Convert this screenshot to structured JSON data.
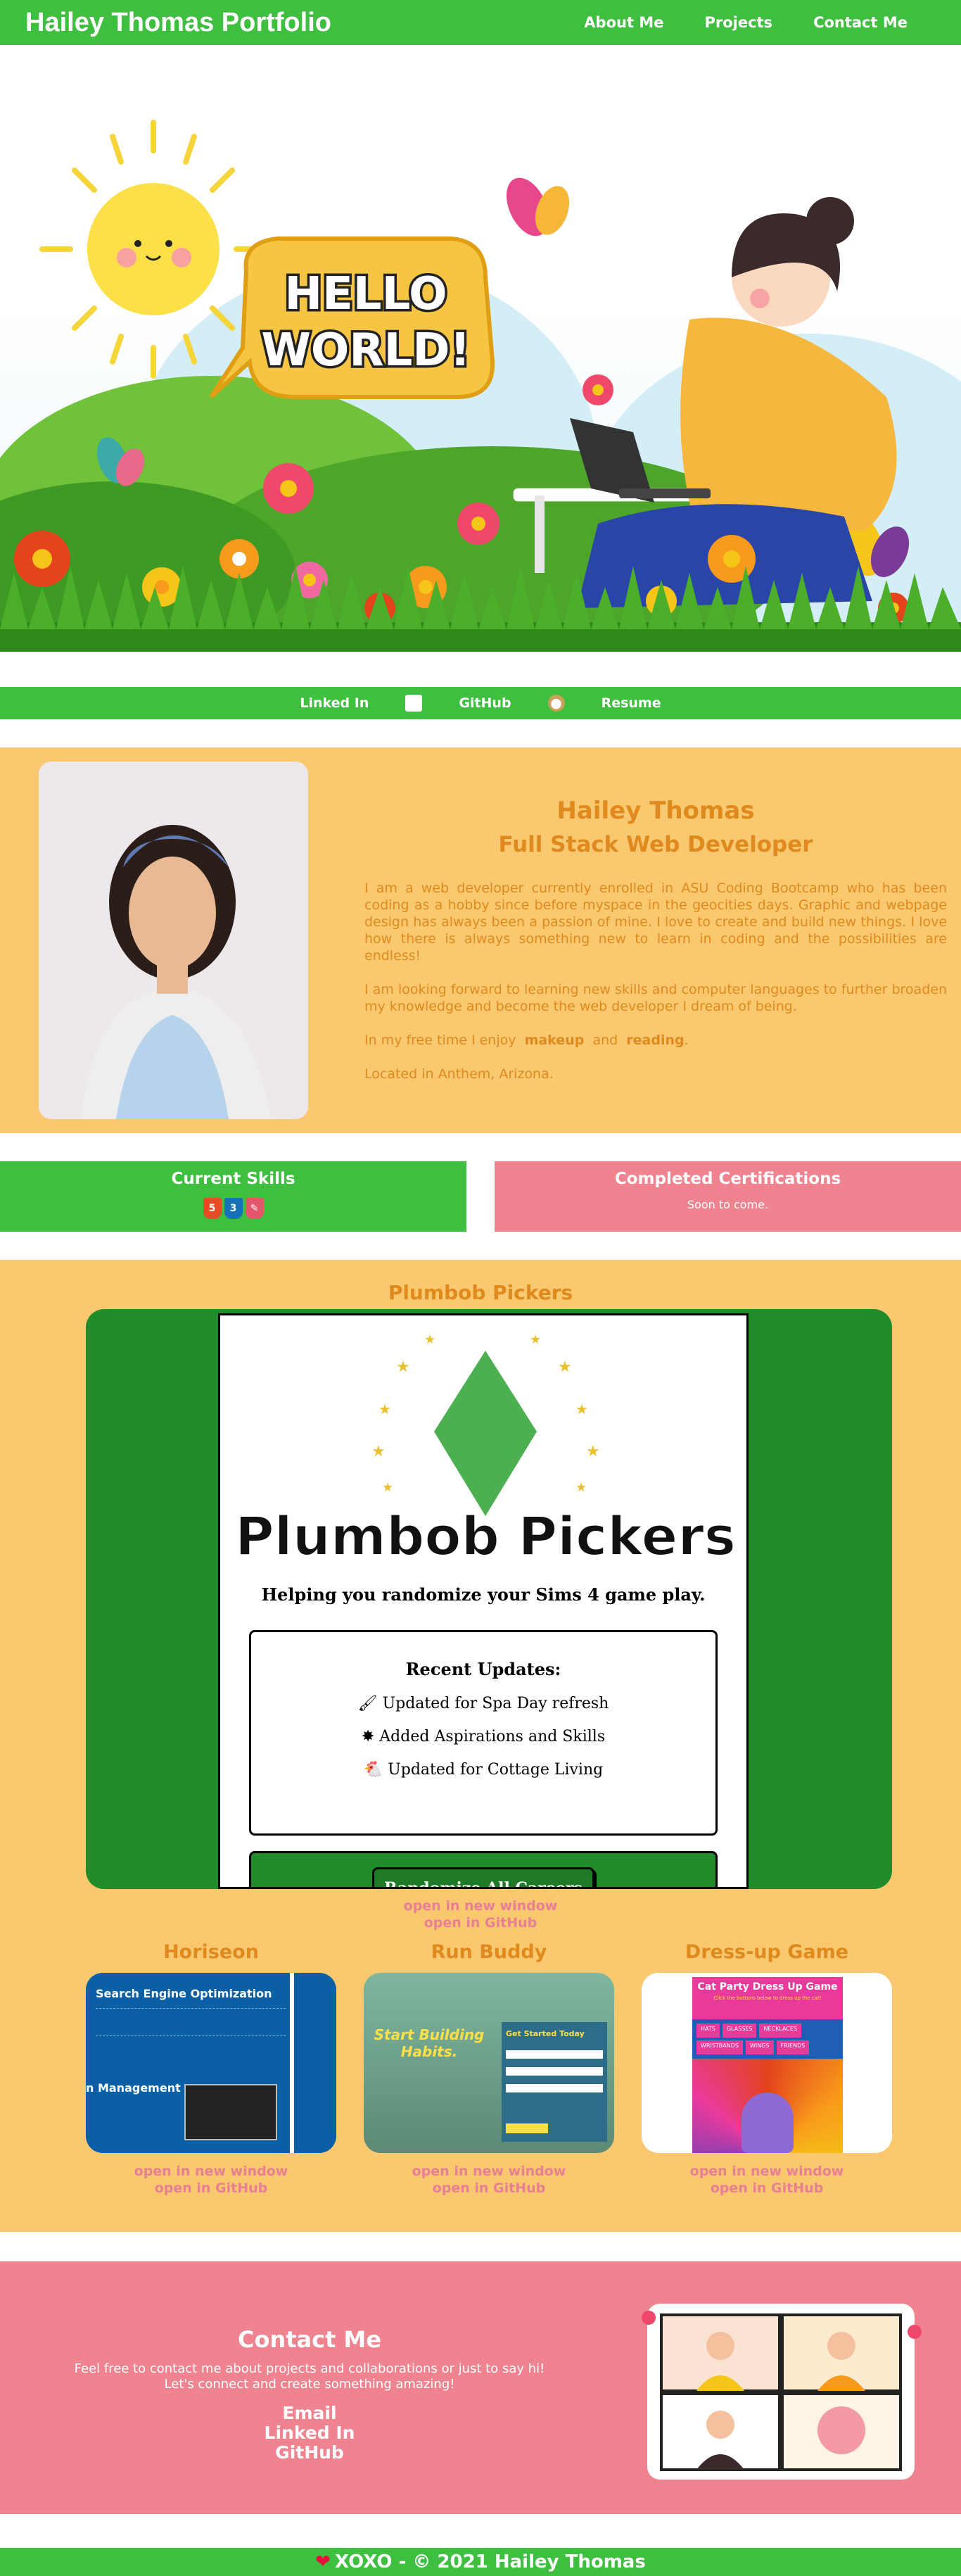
{
  "header": {
    "title": "Hailey Thomas Portfolio",
    "nav": [
      "About Me",
      "Projects",
      "Contact Me"
    ]
  },
  "hero": {
    "speech_bubble": [
      "HELLO",
      "WORLD!"
    ]
  },
  "social": {
    "linkedin": "Linked In",
    "github": "GitHub",
    "resume": "Resume"
  },
  "about": {
    "name": "Hailey Thomas",
    "role": "Full Stack Web Developer",
    "p1": "I am a web developer currently enrolled in ASU Coding Bootcamp who has been coding as a hobby since before myspace in the geocities days. Graphic and webpage design has always been a passion of mine. I love to create and build new things. I love how there is always something new to learn in coding and the possibilities are endless!",
    "p2": "I am looking forward to learning new skills and computer languages to further broaden my knowledge and become the web developer I dream of being.",
    "p3_pre": "In my free time I enjoy",
    "hobby1": "makeup",
    "p3_and": "and",
    "hobby2": "reading",
    "p3_end": ".",
    "p4": "Located in Anthem, Arizona."
  },
  "skills": {
    "title": "Current Skills",
    "icons": [
      "html5-icon",
      "css3-icon",
      "javascript-icon"
    ]
  },
  "certs": {
    "title": "Completed Certifications",
    "text": "Soon to come."
  },
  "projects": {
    "featured_title": "Plumbob Pickers",
    "app": {
      "logo_text": "Plumbob Pickers",
      "tagline": "Helping you randomize your Sims 4 game play.",
      "updates_title": "Recent Updates:",
      "updates": [
        "Updated for Spa Day refresh",
        "Added Aspirations and Skills",
        "Updated for Cottage Living"
      ],
      "button": "Randomize All Careers"
    },
    "link_window": "open in new window",
    "link_github": "open in GitHub",
    "cards": [
      {
        "title": "Horiseon",
        "thumb_heading": "Search Engine Optimization",
        "thumb_sub": "n Management"
      },
      {
        "title": "Run Buddy",
        "thumb_heading": "Start Building Habits.",
        "thumb_form": "Get Started Today"
      },
      {
        "title": "Dress-up Game",
        "thumb_heading": "Cat Party Dress Up Game",
        "thumb_sub": "Click the buttons below to dress up the cat!",
        "thumb_buttons": [
          "HATS",
          "GLASSES",
          "NECKLACES",
          "WRISTBANDS",
          "WINGS",
          "FRIENDS"
        ]
      }
    ]
  },
  "contact": {
    "title": "Contact Me",
    "line1": "Feel free to contact me about projects and collaborations or just to say hi!",
    "line2": "Let's connect and create something amazing!",
    "links": [
      "Email",
      "Linked In",
      "GitHub"
    ]
  },
  "footer": {
    "text": "XOXO - © 2021 Hailey Thomas"
  },
  "colors": {
    "green": "#3fbf3f",
    "dark_green": "#218c2a",
    "peach": "#f9c86f",
    "pink": "#ef8390",
    "orange_text": "#e08a1e"
  }
}
